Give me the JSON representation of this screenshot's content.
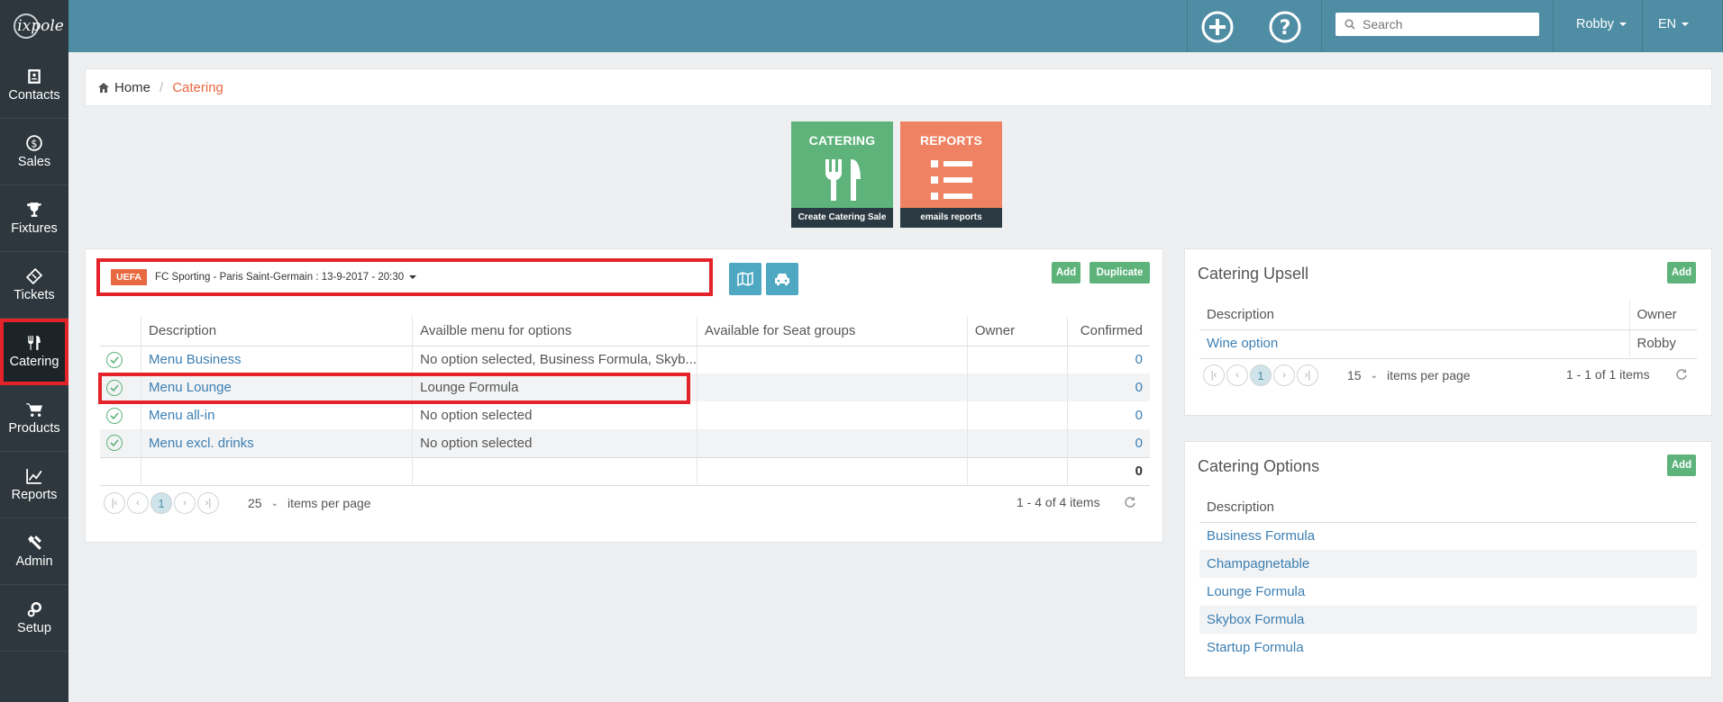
{
  "sidebar": {
    "logo": "ixpole",
    "items": [
      {
        "label": "Contacts",
        "icon": "contact-card-icon"
      },
      {
        "label": "Sales",
        "icon": "dollar-circle-icon"
      },
      {
        "label": "Fixtures",
        "icon": "trophy-icon"
      },
      {
        "label": "Tickets",
        "icon": "ticket-icon"
      },
      {
        "label": "Catering",
        "icon": "fork-knife-icon",
        "active": true
      },
      {
        "label": "Products",
        "icon": "cart-icon"
      },
      {
        "label": "Reports",
        "icon": "line-chart-icon"
      },
      {
        "label": "Admin",
        "icon": "tools-icon"
      },
      {
        "label": "Setup",
        "icon": "gears-icon"
      }
    ]
  },
  "topbar": {
    "search_placeholder": "Search",
    "user": "Robby",
    "lang": "EN",
    "color": "#4f8da4"
  },
  "breadcrumb": {
    "home": "Home",
    "current": "Catering"
  },
  "tiles": [
    {
      "title": "CATERING",
      "footer": "Create Catering Sale",
      "color": "#5eb37b",
      "icon": "fork-knife-icon"
    },
    {
      "title": "REPORTS",
      "footer": "emails reports",
      "color": "#ef8262",
      "icon": "list-icon"
    }
  ],
  "main": {
    "event_badge": "UEFA",
    "event_label": "FC Sporting - Paris Saint-Germain : 13-9-2017 - 20:30",
    "add_label": "Add",
    "duplicate_label": "Duplicate",
    "columns": [
      "Description",
      "Availble menu for options",
      "Available for Seat groups",
      "Owner",
      "Confirmed"
    ],
    "rows": [
      {
        "description": "Menu Business",
        "options": "No option selected, Business Formula, Skyb...",
        "seat_groups": "",
        "owner": "",
        "confirmed": "0"
      },
      {
        "description": "Menu Lounge",
        "options": "Lounge Formula",
        "seat_groups": "",
        "owner": "",
        "confirmed": "0"
      },
      {
        "description": "Menu all-in",
        "options": "No option selected",
        "seat_groups": "",
        "owner": "",
        "confirmed": "0"
      },
      {
        "description": "Menu excl. drinks",
        "options": "No option selected",
        "seat_groups": "",
        "owner": "",
        "confirmed": "0"
      }
    ],
    "total": "0",
    "page": "1",
    "per_page": "25",
    "per_page_label": "items per page",
    "info": "1 - 4 of 4 items"
  },
  "upsell": {
    "title": "Catering Upsell",
    "add_label": "Add",
    "columns": [
      "Description",
      "Owner"
    ],
    "rows": [
      {
        "description": "Wine option",
        "owner": "Robby"
      }
    ],
    "page": "1",
    "per_page": "15",
    "per_page_label": "items per page",
    "info": "1 - 1 of 1 items"
  },
  "options": {
    "title": "Catering Options",
    "add_label": "Add",
    "column": "Description",
    "rows": [
      "Business Formula",
      "Champagnetable",
      "Lounge Formula",
      "Skybox Formula",
      "Startup Formula"
    ]
  }
}
